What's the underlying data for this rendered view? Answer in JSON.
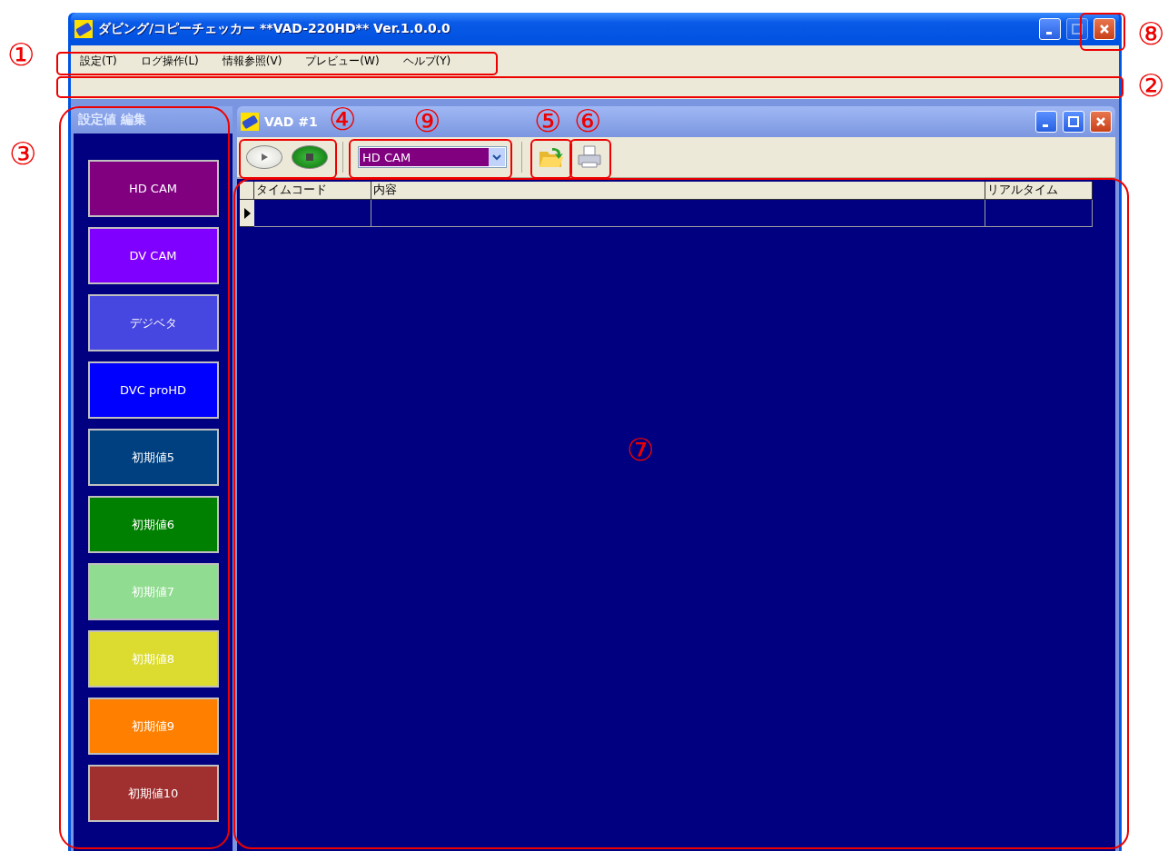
{
  "window": {
    "title": "ダビング/コピーチェッカー **VAD-220HD** Ver.1.0.0.0",
    "maximize_disabled": true
  },
  "menu": [
    "設定(T)",
    "ログ操作(L)",
    "情報参照(V)",
    "プレビュー(W)",
    "ヘルプ(Y)"
  ],
  "sidebar": {
    "title": "設定値 編集",
    "presets": [
      {
        "label": "HD CAM",
        "color": "#800080"
      },
      {
        "label": "DV CAM",
        "color": "#8000ff"
      },
      {
        "label": "デジベタ",
        "color": "#4646e0"
      },
      {
        "label": "DVC proHD",
        "color": "#0000ff"
      },
      {
        "label": "初期値5",
        "color": "#004080"
      },
      {
        "label": "初期値6",
        "color": "#008000"
      },
      {
        "label": "初期値7",
        "color": "#90dc90"
      },
      {
        "label": "初期値8",
        "color": "#dcdc30"
      },
      {
        "label": "初期値9",
        "color": "#ff8000"
      },
      {
        "label": "初期値10",
        "color": "#a03030"
      }
    ]
  },
  "child_window": {
    "title": "VAD #1",
    "format_select": {
      "value": "HD CAM"
    },
    "table": {
      "columns": [
        "タイムコード",
        "内容",
        "リアルタイム"
      ],
      "rows": [
        {
          "current": true
        }
      ]
    }
  },
  "annotations": [
    "①",
    "②",
    "③",
    "④",
    "⑤",
    "⑥",
    "⑦",
    "⑧",
    "⑨"
  ]
}
